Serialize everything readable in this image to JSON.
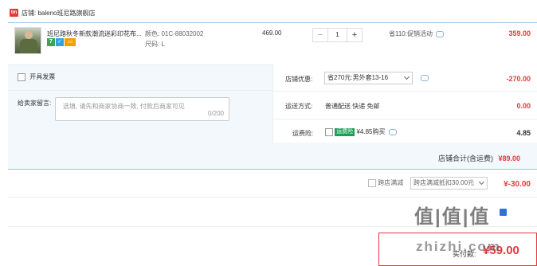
{
  "store": {
    "logo": "tm",
    "label": "店铺: baleno班尼路旗舰店"
  },
  "item": {
    "title": "班尼路秋冬新款潮流迷彩印花布...",
    "color": "颜色: 01C-88032002",
    "size": "尺码: L",
    "badges": [
      "7",
      "",
      ""
    ],
    "price": "469.00",
    "qty_minus": "−",
    "qty": "1",
    "qty_plus": "+",
    "promo": "省110:促销活动",
    "subtotal": "359.00"
  },
  "invoice": {
    "label": "开具发票"
  },
  "store_discount": {
    "label": "店铺优惠:",
    "option": "省270元:男外套13-16",
    "amount": "-270.00"
  },
  "message": {
    "label": "给卖家留言:",
    "placeholder": "选填, 请先和商家协商一致, 付款后商家可见",
    "count": "0/200"
  },
  "shipping": {
    "label": "运送方式:",
    "value": "普通配送 快递 免邮",
    "amount": "0.00"
  },
  "insurance": {
    "label": "运费险:",
    "tag": "运费险",
    "text": "¥4.85购买",
    "amount": "4.85"
  },
  "store_total": {
    "label": "店铺合计(含运费)",
    "amount": "¥89.00"
  },
  "full_reduction": {
    "label": "跨店满减",
    "option": "跨店满减抵扣30.00元",
    "amount": "¥-30.00"
  },
  "pay": {
    "label": "实付款:",
    "amount": "¥59.00"
  },
  "watermark": {
    "big": "值|值|值",
    "url": "zhizhi.com"
  },
  "colors": {
    "price_red": "#e4393c",
    "accent_blue": "#9cc4e5",
    "panel_bg": "#f3f8fd"
  }
}
